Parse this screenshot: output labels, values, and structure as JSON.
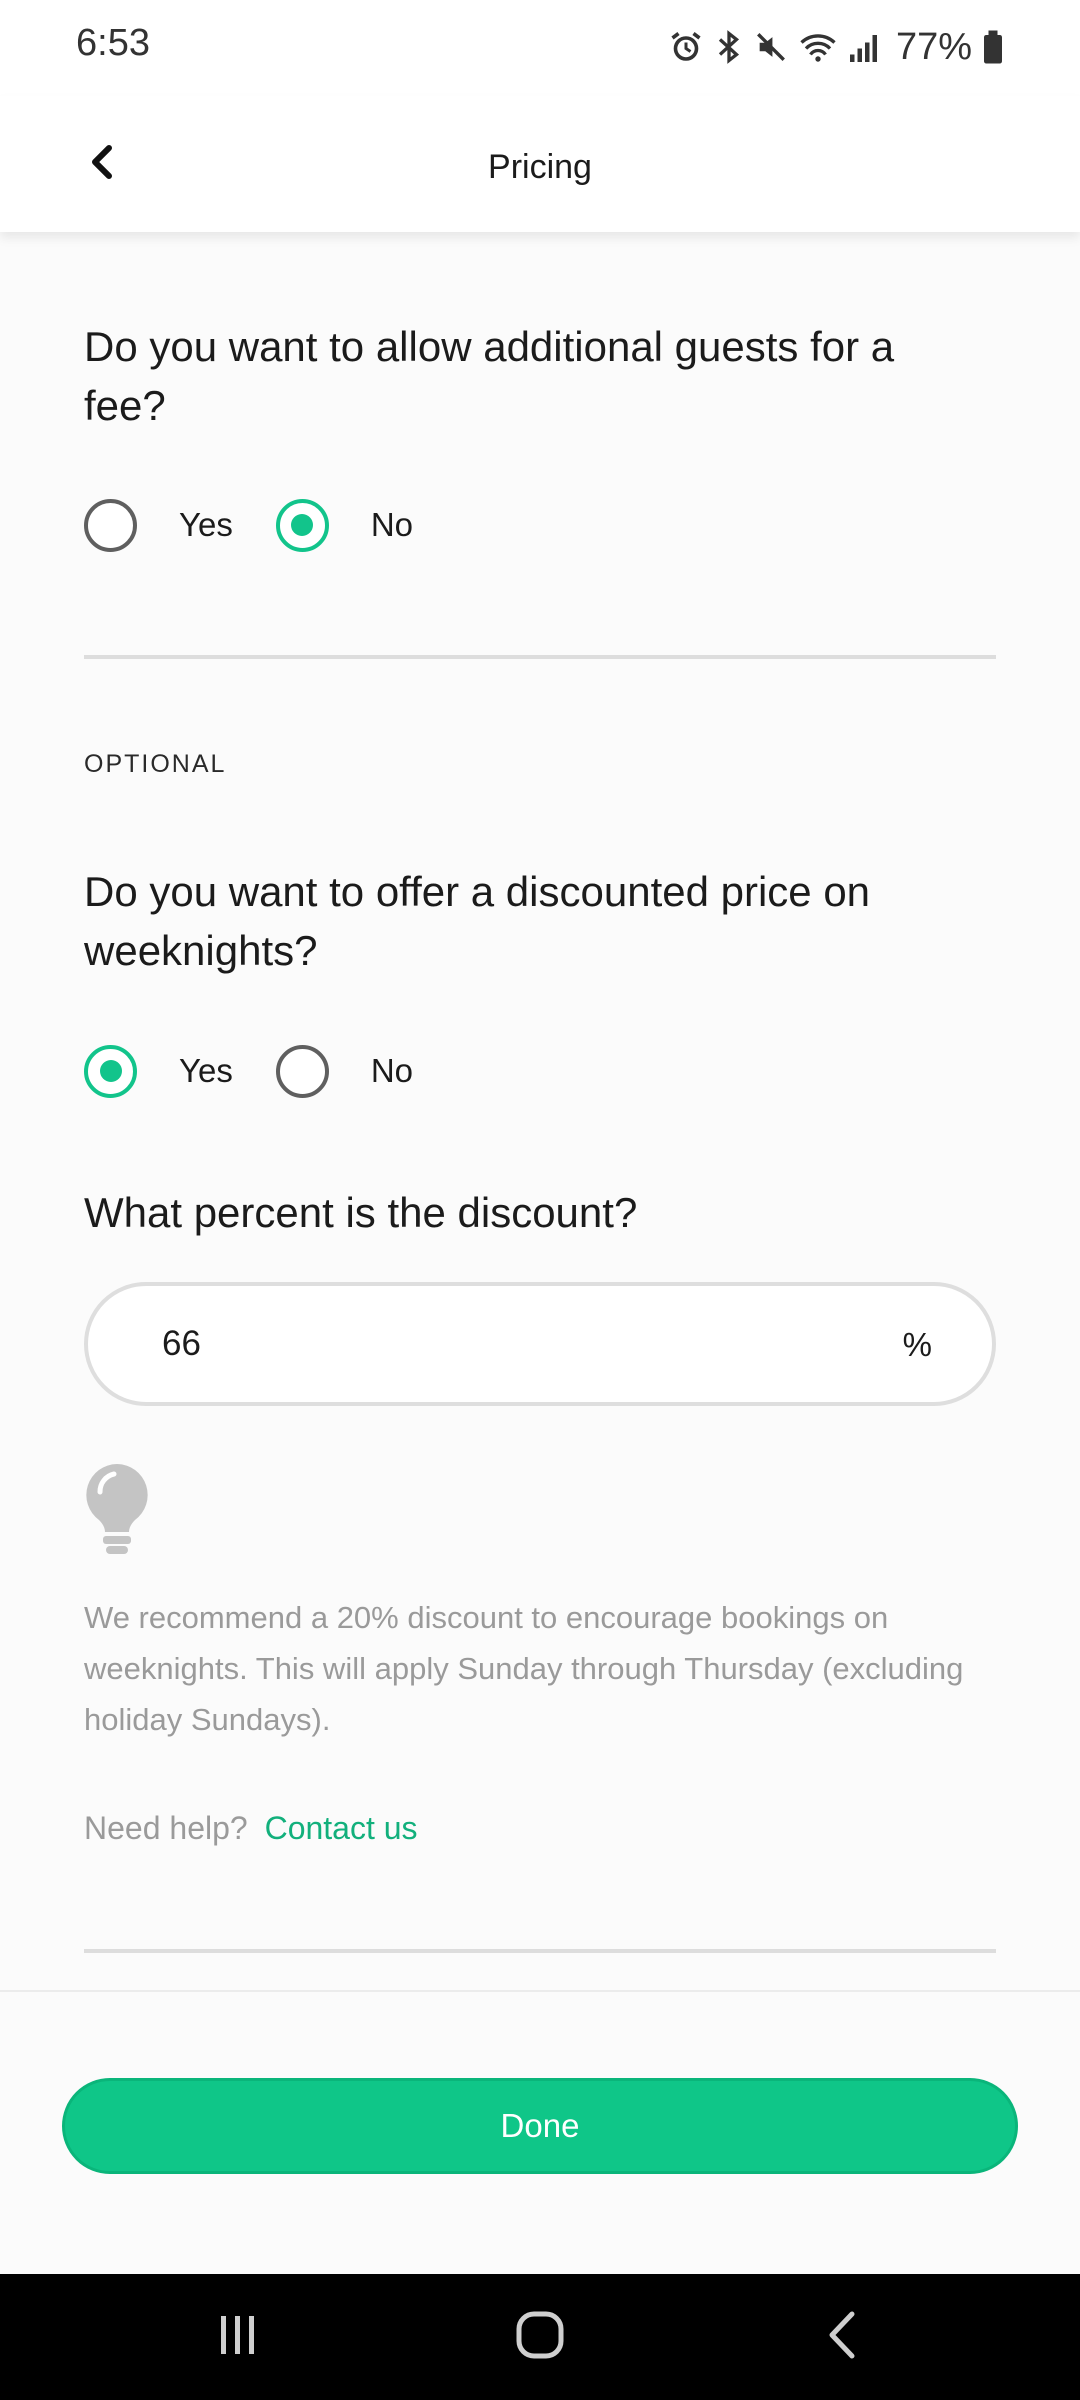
{
  "status_bar": {
    "time": "6:53",
    "battery_percent": "77%",
    "icons": [
      "alarm-icon",
      "bluetooth-icon",
      "mute-icon",
      "wifi-icon",
      "signal-icon",
      "battery-icon"
    ]
  },
  "header": {
    "title": "Pricing",
    "back_icon": "chevron-left-icon"
  },
  "additional_guests": {
    "question": "Do you want to allow additional guests for a fee?",
    "options": [
      {
        "label": "Yes",
        "checked": false
      },
      {
        "label": "No",
        "checked": true
      }
    ]
  },
  "weeknight_discount": {
    "section_label": "OPTIONAL",
    "question": "Do you want to offer a discounted price on weeknights?",
    "options": [
      {
        "label": "Yes",
        "checked": true
      },
      {
        "label": "No",
        "checked": false
      }
    ],
    "percent_question": "What percent is the discount?",
    "percent_value": "66",
    "percent_unit": "%",
    "tip_icon": "lightbulb-icon",
    "tip": "We recommend a 20% discount to encourage bookings on weeknights. This will apply Sunday through Thursday (excluding holiday Sundays).",
    "help_text": "Need help?",
    "help_link": "Contact us"
  },
  "footer": {
    "done_label": "Done"
  },
  "navigation_bar": {
    "buttons": [
      "recent-apps-icon",
      "home-icon",
      "back-icon"
    ]
  },
  "colors": {
    "accent": "#12c48b",
    "button": "#0fc688",
    "link": "#12b07c",
    "muted_text": "#9a9a9a"
  }
}
